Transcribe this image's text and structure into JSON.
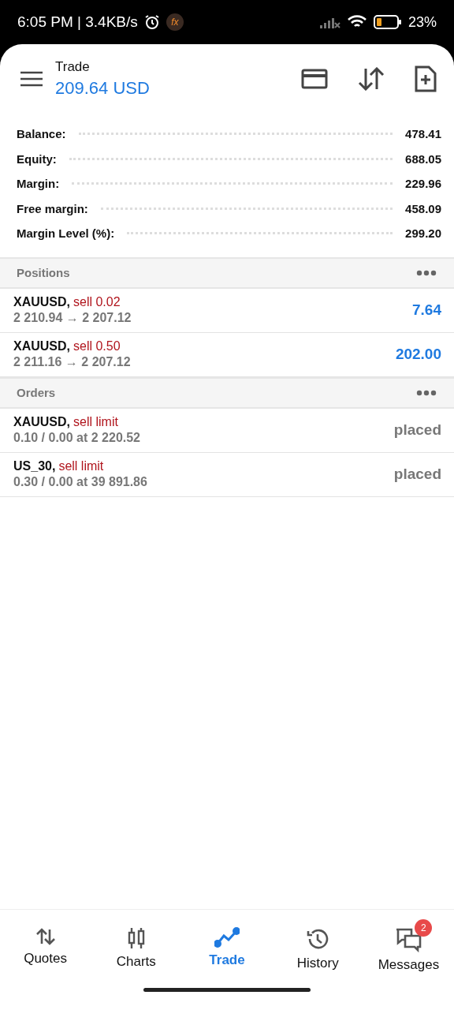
{
  "status_bar": {
    "time": "6:05 PM | 3.4KB/s",
    "app_badge": "fx",
    "battery": "23%"
  },
  "header": {
    "title": "Trade",
    "balance": "209.64 USD"
  },
  "summary": [
    {
      "label": "Balance:",
      "value": "478.41"
    },
    {
      "label": "Equity:",
      "value": "688.05"
    },
    {
      "label": "Margin:",
      "value": "229.96"
    },
    {
      "label": "Free margin:",
      "value": "458.09"
    },
    {
      "label": "Margin Level (%):",
      "value": "299.20"
    }
  ],
  "sections": [
    {
      "title": "Positions",
      "rows": [
        {
          "kind": "position",
          "symbol": "XAUUSD,",
          "action": "sell 0.02",
          "detail": "2 210.94 → 2 207.12",
          "result": "7.64"
        },
        {
          "kind": "position",
          "symbol": "XAUUSD,",
          "action": "sell 0.50",
          "detail": "2 211.16 → 2 207.12",
          "result": "202.00"
        }
      ]
    },
    {
      "title": "Orders",
      "rows": [
        {
          "kind": "order",
          "symbol": "XAUUSD,",
          "action": "sell limit",
          "detail": "0.10 / 0.00 at 2 220.52",
          "result": "placed"
        },
        {
          "kind": "order",
          "symbol": "US_30,",
          "action": "sell limit",
          "detail": "0.30 / 0.00 at 39 891.86",
          "result": "placed"
        }
      ]
    }
  ],
  "tabs": [
    {
      "label": "Quotes",
      "selected": false
    },
    {
      "label": "Charts",
      "selected": false
    },
    {
      "label": "Trade",
      "selected": true
    },
    {
      "label": "History",
      "selected": false
    },
    {
      "label": "Messages",
      "selected": false,
      "badge": "2"
    }
  ]
}
